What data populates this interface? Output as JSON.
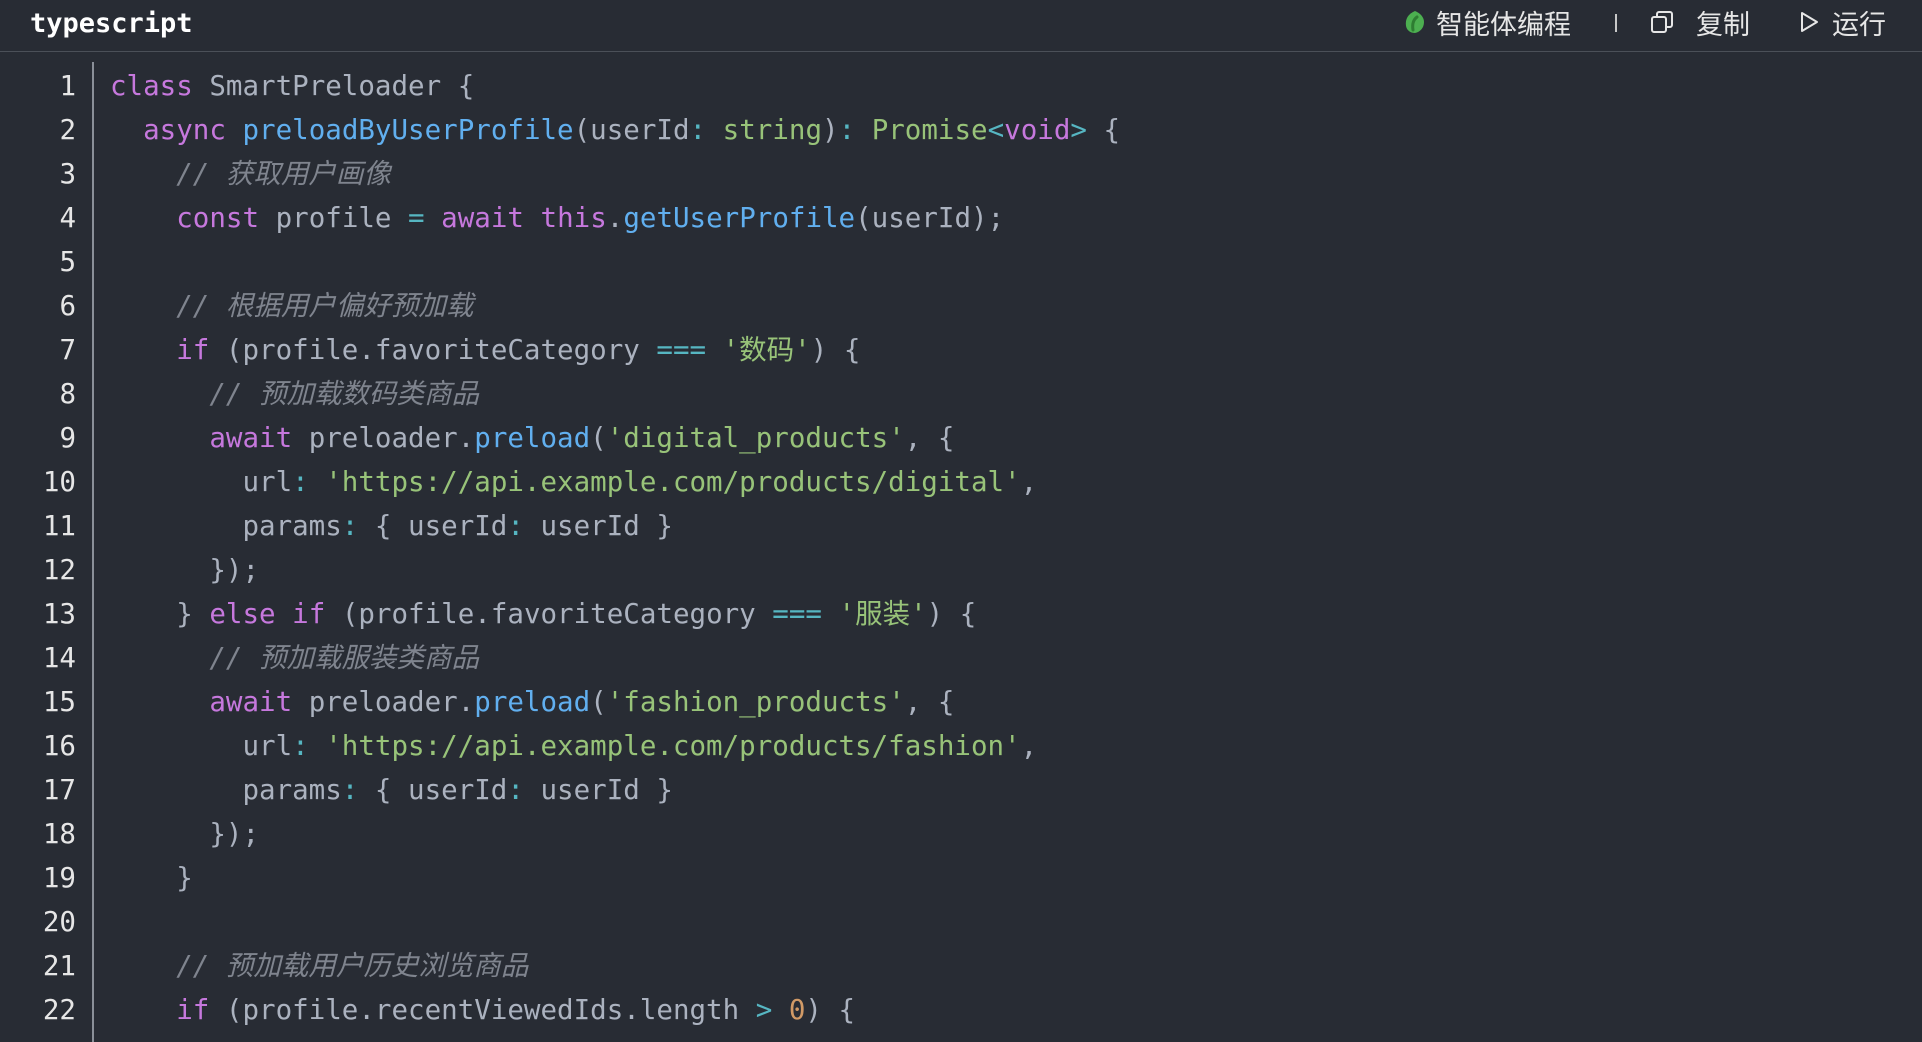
{
  "header": {
    "language": "typescript",
    "agent_label": "智能体编程",
    "copy_label": "复制",
    "run_label": "运行",
    "agent_icon": "agent-leaf-icon",
    "copy_icon": "copy-icon",
    "run_icon": "play-icon",
    "agent_icon_color": "#4caf50"
  },
  "colors": {
    "background": "#282c34",
    "keyword": "#c678dd",
    "function": "#61afef",
    "string": "#98c379",
    "comment": "#7f848e",
    "operator": "#56b6c2",
    "number": "#98c379",
    "text": "#abb2bf"
  },
  "code": {
    "lines": [
      {
        "n": "1",
        "tokens": [
          {
            "t": "kw",
            "v": "class"
          },
          {
            "t": "plain",
            "v": " SmartPreloader {"
          }
        ]
      },
      {
        "n": "2",
        "tokens": [
          {
            "t": "plain",
            "v": "  "
          },
          {
            "t": "kw",
            "v": "async"
          },
          {
            "t": "plain",
            "v": " "
          },
          {
            "t": "fn",
            "v": "preloadByUserProfile"
          },
          {
            "t": "plain",
            "v": "(userId"
          },
          {
            "t": "op",
            "v": ":"
          },
          {
            "t": "plain",
            "v": " "
          },
          {
            "t": "type",
            "v": "string"
          },
          {
            "t": "plain",
            "v": ")"
          },
          {
            "t": "op",
            "v": ":"
          },
          {
            "t": "plain",
            "v": " "
          },
          {
            "t": "type",
            "v": "Promise"
          },
          {
            "t": "op",
            "v": "<"
          },
          {
            "t": "kw",
            "v": "void"
          },
          {
            "t": "op",
            "v": ">"
          },
          {
            "t": "plain",
            "v": " {"
          }
        ]
      },
      {
        "n": "3",
        "tokens": [
          {
            "t": "plain",
            "v": "    "
          },
          {
            "t": "com",
            "v": "// 获取用户画像"
          }
        ]
      },
      {
        "n": "4",
        "tokens": [
          {
            "t": "plain",
            "v": "    "
          },
          {
            "t": "kw",
            "v": "const"
          },
          {
            "t": "plain",
            "v": " profile "
          },
          {
            "t": "op",
            "v": "="
          },
          {
            "t": "plain",
            "v": " "
          },
          {
            "t": "kw",
            "v": "await"
          },
          {
            "t": "plain",
            "v": " "
          },
          {
            "t": "kw",
            "v": "this"
          },
          {
            "t": "plain",
            "v": "."
          },
          {
            "t": "fn",
            "v": "getUserProfile"
          },
          {
            "t": "plain",
            "v": "(userId);"
          }
        ]
      },
      {
        "n": "5",
        "tokens": []
      },
      {
        "n": "6",
        "tokens": [
          {
            "t": "plain",
            "v": "    "
          },
          {
            "t": "com",
            "v": "// 根据用户偏好预加载"
          }
        ]
      },
      {
        "n": "7",
        "tokens": [
          {
            "t": "plain",
            "v": "    "
          },
          {
            "t": "kw",
            "v": "if"
          },
          {
            "t": "plain",
            "v": " (profile.favoriteCategory "
          },
          {
            "t": "op",
            "v": "==="
          },
          {
            "t": "plain",
            "v": " "
          },
          {
            "t": "str",
            "v": "'数码'"
          },
          {
            "t": "plain",
            "v": ") {"
          }
        ]
      },
      {
        "n": "8",
        "tokens": [
          {
            "t": "plain",
            "v": "      "
          },
          {
            "t": "com",
            "v": "// 预加载数码类商品"
          }
        ]
      },
      {
        "n": "9",
        "tokens": [
          {
            "t": "plain",
            "v": "      "
          },
          {
            "t": "kw",
            "v": "await"
          },
          {
            "t": "plain",
            "v": " preloader."
          },
          {
            "t": "fn",
            "v": "preload"
          },
          {
            "t": "plain",
            "v": "("
          },
          {
            "t": "str",
            "v": "'digital_products'"
          },
          {
            "t": "plain",
            "v": ", {"
          }
        ]
      },
      {
        "n": "10",
        "tokens": [
          {
            "t": "plain",
            "v": "        url"
          },
          {
            "t": "op",
            "v": ":"
          },
          {
            "t": "plain",
            "v": " "
          },
          {
            "t": "str",
            "v": "'https://api.example.com/products/digital'"
          },
          {
            "t": "plain",
            "v": ","
          }
        ]
      },
      {
        "n": "11",
        "tokens": [
          {
            "t": "plain",
            "v": "        params"
          },
          {
            "t": "op",
            "v": ":"
          },
          {
            "t": "plain",
            "v": " { userId"
          },
          {
            "t": "op",
            "v": ":"
          },
          {
            "t": "plain",
            "v": " userId }"
          }
        ]
      },
      {
        "n": "12",
        "tokens": [
          {
            "t": "plain",
            "v": "      });"
          }
        ]
      },
      {
        "n": "13",
        "tokens": [
          {
            "t": "plain",
            "v": "    } "
          },
          {
            "t": "kw",
            "v": "else"
          },
          {
            "t": "plain",
            "v": " "
          },
          {
            "t": "kw",
            "v": "if"
          },
          {
            "t": "plain",
            "v": " (profile.favoriteCategory "
          },
          {
            "t": "op",
            "v": "==="
          },
          {
            "t": "plain",
            "v": " "
          },
          {
            "t": "str",
            "v": "'服装'"
          },
          {
            "t": "plain",
            "v": ") {"
          }
        ]
      },
      {
        "n": "14",
        "tokens": [
          {
            "t": "plain",
            "v": "      "
          },
          {
            "t": "com",
            "v": "// 预加载服装类商品"
          }
        ]
      },
      {
        "n": "15",
        "tokens": [
          {
            "t": "plain",
            "v": "      "
          },
          {
            "t": "kw",
            "v": "await"
          },
          {
            "t": "plain",
            "v": " preloader."
          },
          {
            "t": "fn",
            "v": "preload"
          },
          {
            "t": "plain",
            "v": "("
          },
          {
            "t": "str",
            "v": "'fashion_products'"
          },
          {
            "t": "plain",
            "v": ", {"
          }
        ]
      },
      {
        "n": "16",
        "tokens": [
          {
            "t": "plain",
            "v": "        url"
          },
          {
            "t": "op",
            "v": ":"
          },
          {
            "t": "plain",
            "v": " "
          },
          {
            "t": "str",
            "v": "'https://api.example.com/products/fashion'"
          },
          {
            "t": "plain",
            "v": ","
          }
        ]
      },
      {
        "n": "17",
        "tokens": [
          {
            "t": "plain",
            "v": "        params"
          },
          {
            "t": "op",
            "v": ":"
          },
          {
            "t": "plain",
            "v": " { userId"
          },
          {
            "t": "op",
            "v": ":"
          },
          {
            "t": "plain",
            "v": " userId }"
          }
        ]
      },
      {
        "n": "18",
        "tokens": [
          {
            "t": "plain",
            "v": "      });"
          }
        ]
      },
      {
        "n": "19",
        "tokens": [
          {
            "t": "plain",
            "v": "    }"
          }
        ]
      },
      {
        "n": "20",
        "tokens": []
      },
      {
        "n": "21",
        "tokens": [
          {
            "t": "plain",
            "v": "    "
          },
          {
            "t": "com",
            "v": "// 预加载用户历史浏览商品"
          }
        ]
      },
      {
        "n": "22",
        "tokens": [
          {
            "t": "plain",
            "v": "    "
          },
          {
            "t": "kw",
            "v": "if"
          },
          {
            "t": "plain",
            "v": " (profile.recentViewedIds.length "
          },
          {
            "t": "op",
            "v": ">"
          },
          {
            "t": "plain",
            "v": " "
          },
          {
            "t": "num",
            "v": "0"
          },
          {
            "t": "plain",
            "v": ") {"
          }
        ]
      }
    ]
  }
}
